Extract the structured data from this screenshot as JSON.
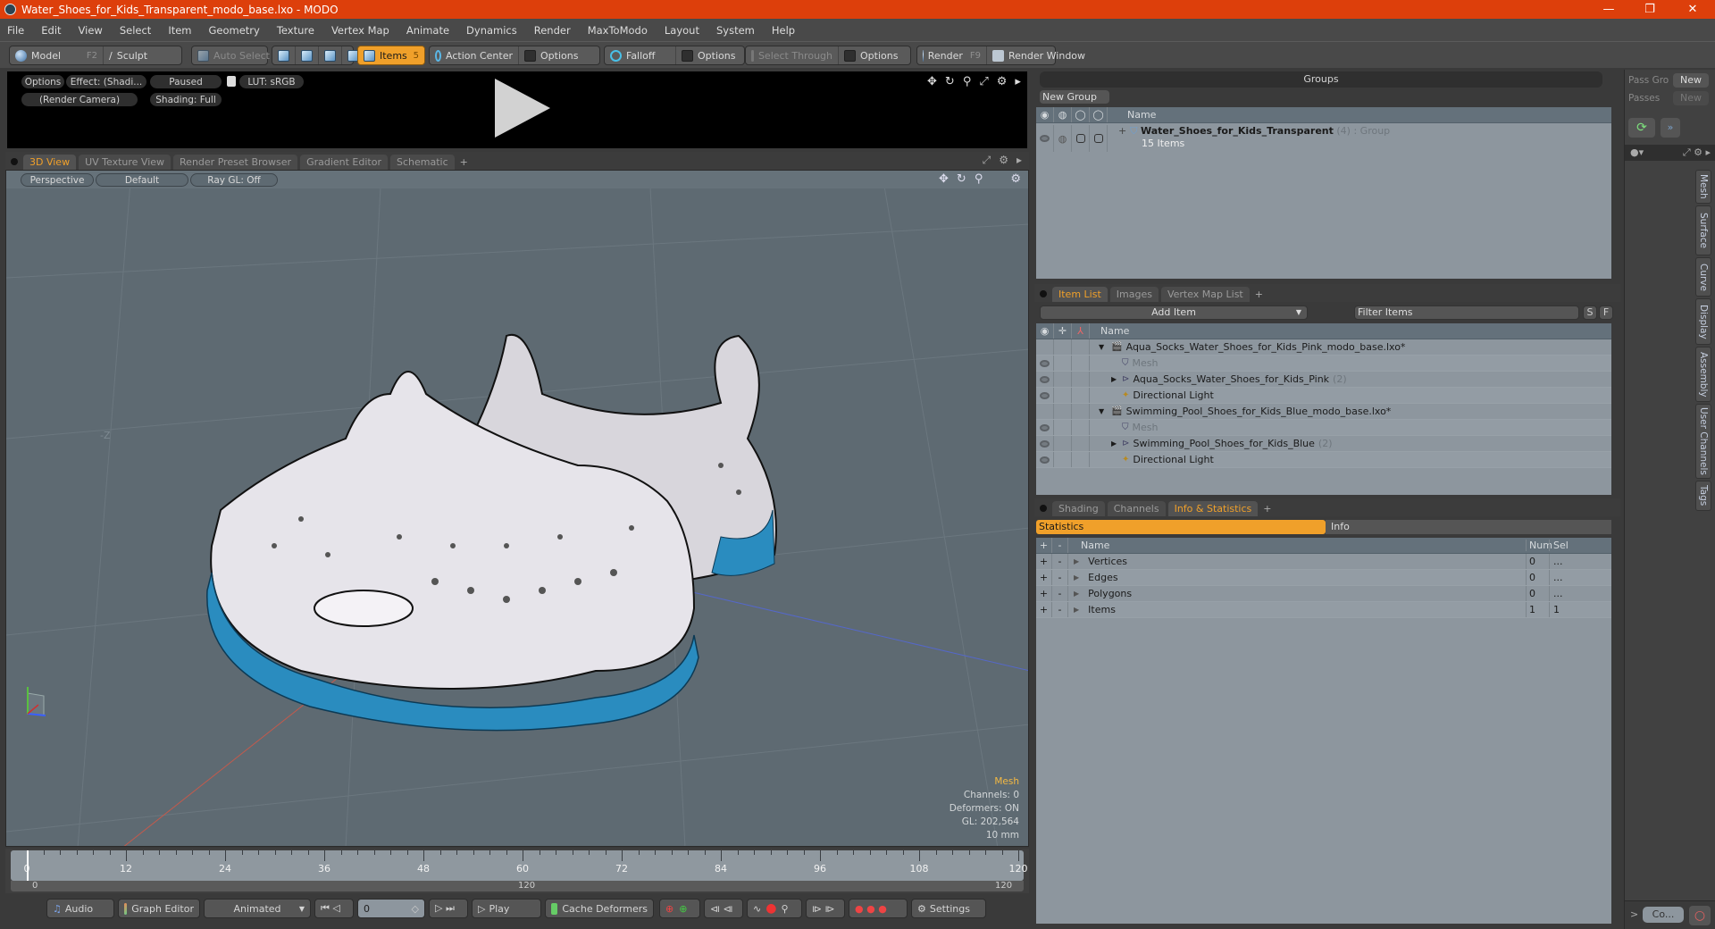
{
  "window": {
    "title": "Water_Shoes_for_Kids_Transparent_modo_base.lxo - MODO",
    "controls": [
      "minimize-icon",
      "restore-icon",
      "close-icon"
    ]
  },
  "menu": [
    "File",
    "Edit",
    "View",
    "Select",
    "Item",
    "Geometry",
    "Texture",
    "Vertex Map",
    "Animate",
    "Dynamics",
    "Render",
    "MaxToModo",
    "Layout",
    "System",
    "Help"
  ],
  "toolbar": {
    "model": "Model",
    "model_key": "F2",
    "sculpt": "Sculpt",
    "auto_select": "Auto Select",
    "items": "Items",
    "items_key": "5",
    "action_center": "Action Center",
    "options1": "Options",
    "falloff": "Falloff",
    "options2": "Options",
    "select_through": "Select Through",
    "options3": "Options",
    "render": "Render",
    "render_key": "F9",
    "render_window": "Render Window"
  },
  "render_preview": {
    "options": "Options",
    "effect": "Effect: (Shadi...",
    "paused": "Paused",
    "lut": "LUT: sRGB",
    "camera": "(Render Camera)",
    "shading": "Shading: Full"
  },
  "viewport_tabs": [
    "3D View",
    "UV Texture View",
    "Render Preset Browser",
    "Gradient Editor",
    "Schematic",
    "+"
  ],
  "viewport": {
    "perspective": "Perspective",
    "default": "Default",
    "raygl": "Ray GL: Off",
    "axis_label": "-Z",
    "stats": {
      "title": "Mesh",
      "channels": "Channels: 0",
      "deformers": "Deformers: ON",
      "gl": "GL: 202,564",
      "units": "10 mm"
    },
    "colors": {
      "background": "#5e6a72",
      "shoe_upper": "#e8e6ec",
      "sole": "#2a8cbf",
      "wire": "#101010"
    }
  },
  "timeline": {
    "ticks": [
      "0",
      "12",
      "24",
      "36",
      "48",
      "60",
      "72",
      "84",
      "96",
      "108",
      "120"
    ],
    "range_start": "0",
    "range_mid": "120",
    "range_end": "120"
  },
  "bottom": {
    "audio": "Audio",
    "graph_editor": "Graph Editor",
    "animated": "Animated",
    "frame": "0",
    "play": "Play",
    "cache": "Cache Deformers",
    "settings": "Settings"
  },
  "groups": {
    "title": "Groups",
    "new_group": "New Group",
    "name_col": "Name",
    "item": {
      "name": "Water_Shoes_for_Kids_Transparent",
      "count": "(4)",
      "type": ": Group",
      "sub": "15 Items"
    }
  },
  "pass": {
    "pass_groups": "Pass Gro",
    "passes": "Passes",
    "new1": "New",
    "new2": "New"
  },
  "item_list": {
    "tabs": [
      "Item List",
      "Images",
      "Vertex Map List",
      "+"
    ],
    "add_item": "Add Item",
    "filter": "Filter Items",
    "s": "S",
    "f": "F",
    "name_col": "Name",
    "rows": [
      {
        "label": "Aqua_Socks_Water_Shoes_for_Kids_Pink_modo_base.lxo*",
        "level": 0,
        "type": "scene",
        "eye": false
      },
      {
        "label": "Mesh",
        "level": 1,
        "type": "mesh",
        "eye": true,
        "dim": true
      },
      {
        "label": "Aqua_Socks_Water_Shoes_for_Kids_Pink",
        "count": "(2)",
        "level": 1,
        "type": "group",
        "eye": true
      },
      {
        "label": "Directional Light",
        "level": 1,
        "type": "light",
        "eye": true
      },
      {
        "label": "Swimming_Pool_Shoes_for_Kids_Blue_modo_base.lxo*",
        "level": 0,
        "type": "scene",
        "eye": false
      },
      {
        "label": "Mesh",
        "level": 1,
        "type": "mesh",
        "eye": true,
        "dim": true
      },
      {
        "label": "Swimming_Pool_Shoes_for_Kids_Blue",
        "count": "(2)",
        "level": 1,
        "type": "group",
        "eye": true
      },
      {
        "label": "Directional Light",
        "level": 1,
        "type": "light",
        "eye": true
      }
    ]
  },
  "info": {
    "tabs": [
      "Shading",
      "Channels",
      "Info & Statistics",
      "+"
    ],
    "statistics": "Statistics",
    "info": "Info",
    "cols": {
      "name": "Name",
      "num": "Num",
      "sel": "Sel"
    },
    "rows": [
      {
        "name": "Vertices",
        "num": "0",
        "sel": "..."
      },
      {
        "name": "Edges",
        "num": "0",
        "sel": "..."
      },
      {
        "name": "Polygons",
        "num": "0",
        "sel": "..."
      },
      {
        "name": "Items",
        "num": "1",
        "sel": "1"
      }
    ]
  },
  "side_tabs": [
    "Mesh",
    "Surface",
    "Curve",
    "Display",
    "Assembly",
    "User Channels",
    "Tags"
  ],
  "command": {
    "prompt": ">",
    "placeholder": "Co..."
  }
}
